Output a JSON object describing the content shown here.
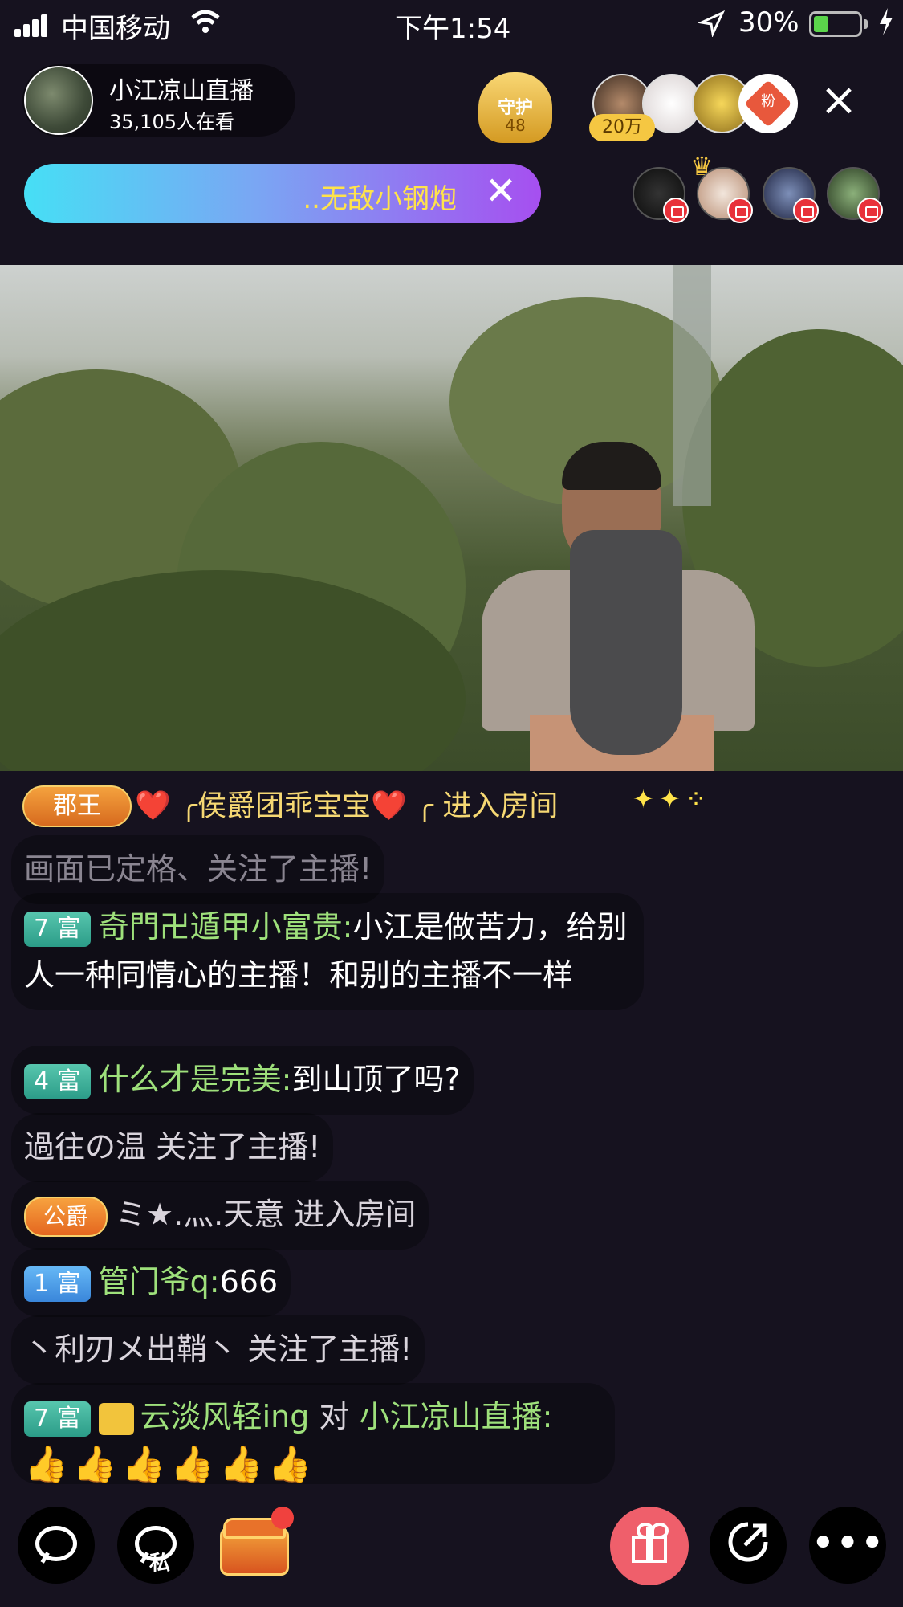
{
  "status_bar": {
    "carrier": "中国移动",
    "time": "下午1:54",
    "battery_percent": "30%",
    "battery_level": 0.3
  },
  "host": {
    "name": "小江凉山直播",
    "viewers": "35,105人在看"
  },
  "guard": {
    "label": "守护",
    "count": "48"
  },
  "fans": {
    "top_badge": "20万",
    "fan_badge": "粉"
  },
  "banner": {
    "text": "..无敌小钢炮"
  },
  "chat": {
    "entry_announcement": {
      "rank": "郡王",
      "text": "❤️ ╭侯爵团乖宝宝❤️ ╭ 进入房间"
    },
    "faded_message": "画面已定格、关注了主播!",
    "messages": [
      {
        "level": "7 富",
        "nick": "奇門卍遁甲小富贵:",
        "text": "小江是做苦力，给别人一种同情心的主播！和别的主播不一样"
      },
      {
        "level": "4 富",
        "nick": "什么才是完美:",
        "text": "到山顶了吗?"
      },
      {
        "system": "過往の温 关注了主播!"
      },
      {
        "rank": "公爵",
        "system": "ミ★.灬.天意 进入房间"
      },
      {
        "level": "1 富",
        "nick": "管门爷q:",
        "text": "666"
      },
      {
        "system": "丶利刃メ出鞘丶 关注了主播!"
      },
      {
        "level": "7 富",
        "nick": "云淡风轻ing",
        "to": "对",
        "target": "小江凉山直播:",
        "text": "👍👍👍👍👍👍"
      }
    ]
  },
  "bottom_bar": {
    "private_label": "私"
  },
  "colors": {
    "accent_yellow": "#ffe34a",
    "nick_green": "#9ee07b",
    "gift_pink": "#ef5f6b"
  }
}
